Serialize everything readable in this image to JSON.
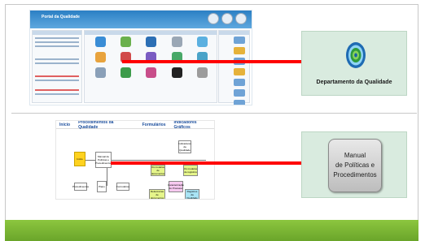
{
  "slide": {
    "top_destination": {
      "label": "Departamento da Qualidade",
      "icon": "target-icon"
    },
    "bottom_destination": {
      "lines": [
        "Manual",
        "de Políticas e",
        "Procedimentos"
      ]
    }
  },
  "screenshot_dashboard": {
    "header_title": "Portal da Qualidade"
  },
  "screenshot_flowchart": {
    "menu": [
      "Início",
      "Procedimentos da Qualidade",
      "Formulários",
      "Indicadores Gráficos"
    ],
    "boxes": {
      "start": "Início",
      "manual": "Manual de Políticas e Procedimentos",
      "indicators": "Indicadores da Qualidade",
      "p1": "Procedimentos",
      "p2": "Plano",
      "p3": "Formulários",
      "g1": "Os modelos de documentos",
      "g2": "Os modelos de registros",
      "pink1": "Caracterização do Processo",
      "g3": "Referências de documentos",
      "blue1": "Registros da Qualidade"
    }
  },
  "colors": {
    "arrow": "#ff0000",
    "footer": "#7ab536",
    "tile": "#d9ebdf"
  }
}
